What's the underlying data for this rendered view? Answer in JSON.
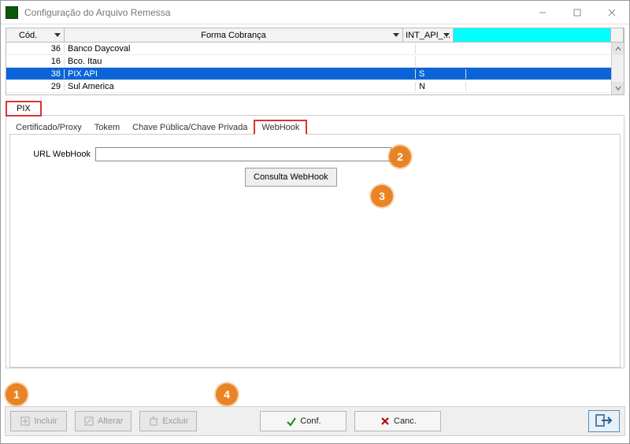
{
  "window": {
    "title": "Configuração do Arquivo Remessa"
  },
  "grid": {
    "columns": {
      "cod": "Cód.",
      "forma": "Forma Cobrança",
      "int": "INT_API_..."
    },
    "rows": [
      {
        "cod": "36",
        "forma": "Banco Daycoval",
        "int": ""
      },
      {
        "cod": "16",
        "forma": "Bco. Itau",
        "int": ""
      },
      {
        "cod": "38",
        "forma": "PIX API",
        "int": "S",
        "selected": true
      },
      {
        "cod": "29",
        "forma": "Sul America",
        "int": "N"
      }
    ]
  },
  "outerTab": {
    "pix": "PIX"
  },
  "innerTabs": {
    "cert": "Certificado/Proxy",
    "token": "Tokem",
    "chave": "Chave Pública/Chave Privada",
    "webhook": "WebHook"
  },
  "webhookPanel": {
    "urlLabel": "URL WebHook",
    "urlValue": "",
    "consultBtn": "Consulta WebHook"
  },
  "callouts": {
    "c1": "1",
    "c2": "2",
    "c3": "3",
    "c4": "4"
  },
  "bottom": {
    "incluir": "Incluir",
    "alterar": "Alterar",
    "excluir": "Excluir",
    "conf": "Conf.",
    "canc": "Canc."
  }
}
